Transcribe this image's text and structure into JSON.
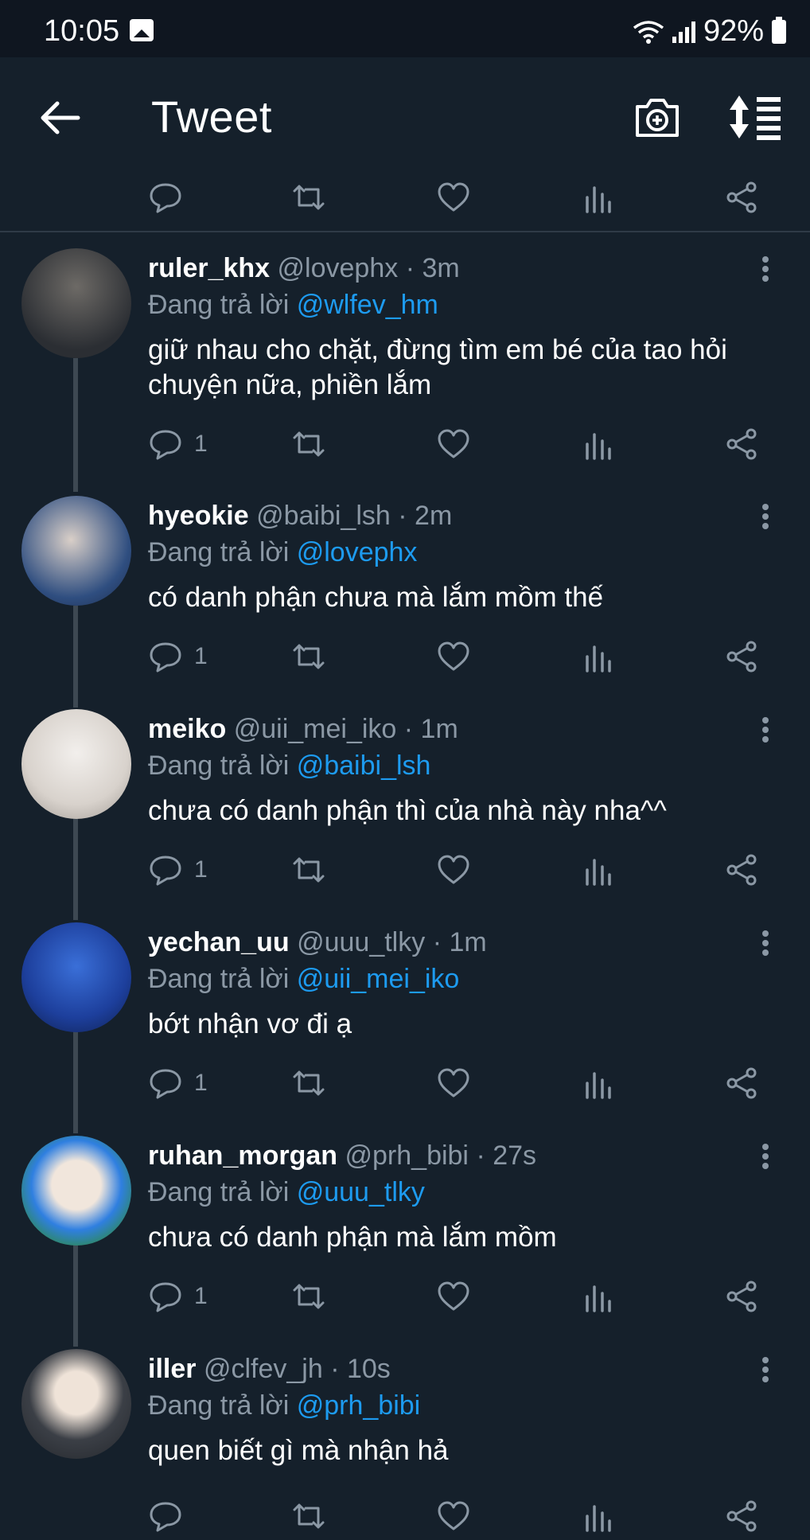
{
  "status_bar": {
    "time": "10:05",
    "battery": "92%"
  },
  "header": {
    "title": "Tweet",
    "icons": [
      "back-arrow-icon",
      "camera-add-icon",
      "sort-icon"
    ]
  },
  "top_actions": {
    "icons": [
      "reply-icon",
      "retweet-icon",
      "like-icon",
      "views-icon",
      "share-icon"
    ]
  },
  "tweets": [
    {
      "display_name": "ruler_khx",
      "handle": "@lovephx",
      "time": "· 3m",
      "reply_label": "Đang trả lời",
      "reply_to": "@wlfev_hm",
      "text": "giữ nhau cho chặt, đừng tìm em bé của tao hỏi chuyện nữa, phiền lắm",
      "reply_count": "1"
    },
    {
      "display_name": "hyeokie",
      "handle": "@baibi_lsh",
      "time": "· 2m",
      "reply_label": "Đang trả lời",
      "reply_to": "@lovephx",
      "text": "có danh phận chưa mà lắm mồm thế",
      "reply_count": "1"
    },
    {
      "display_name": "meiko",
      "handle": "@uii_mei_iko",
      "time": "· 1m",
      "reply_label": "Đang trả lời",
      "reply_to": "@baibi_lsh",
      "text": "chưa có danh phận thì của nhà này nha^^",
      "reply_count": "1"
    },
    {
      "display_name": "yechan_uu",
      "handle": "@uuu_tlky",
      "time": "· 1m",
      "reply_label": "Đang trả lời",
      "reply_to": "@uii_mei_iko",
      "text": "bớt nhận vơ đi ạ",
      "reply_count": "1"
    },
    {
      "display_name": "ruhan_morgan",
      "handle": "@prh_bibi",
      "time": "· 27s",
      "reply_label": "Đang trả lời",
      "reply_to": "@uuu_tlky",
      "text": "chưa có danh phận mà lắm mồm",
      "reply_count": "1"
    },
    {
      "display_name": "iller",
      "handle": "@clfev_jh",
      "time": "· 10s",
      "reply_label": "Đang trả lời",
      "reply_to": "@prh_bibi",
      "text": "quen biết gì mà nhận hả",
      "reply_count": ""
    }
  ],
  "colors": {
    "background": "#15202b",
    "status_bar": "#0f1620",
    "secondary_text": "#8b98a5",
    "mention": "#1d9bf0",
    "thread_line": "#3d4852"
  }
}
